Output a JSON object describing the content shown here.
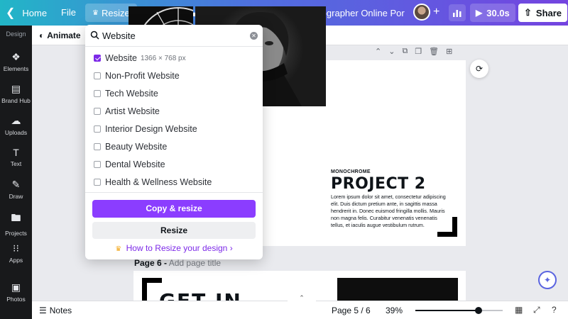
{
  "topbar": {
    "home_label": "Home",
    "file_label": "File",
    "resize_label": "Resize",
    "title": "White Black Modern Photographer Online Portf…",
    "play_label": "30.0s",
    "share_label": "Share"
  },
  "sidebar": {
    "design_label": "Design",
    "items": [
      {
        "label": "Elements",
        "icon": "elements-icon"
      },
      {
        "label": "Brand Hub",
        "icon": "brand-hub-icon"
      },
      {
        "label": "Uploads",
        "icon": "uploads-icon"
      },
      {
        "label": "Text",
        "icon": "text-icon"
      },
      {
        "label": "Draw",
        "icon": "draw-icon"
      },
      {
        "label": "Projects",
        "icon": "projects-icon"
      },
      {
        "label": "Apps",
        "icon": "apps-icon"
      },
      {
        "label": "Photos",
        "icon": "photos-icon"
      }
    ]
  },
  "toolbar": {
    "animate_label": "Animate"
  },
  "resize_panel": {
    "search_value": "Website",
    "options": [
      {
        "label": "Website",
        "dims": "1366 × 768 px",
        "checked": true
      },
      {
        "label": "Non-Profit Website",
        "checked": false
      },
      {
        "label": "Tech Website",
        "checked": false
      },
      {
        "label": "Artist Website",
        "checked": false
      },
      {
        "label": "Interior Design Website",
        "checked": false
      },
      {
        "label": "Beauty Website",
        "checked": false
      },
      {
        "label": "Dental Website",
        "checked": false
      },
      {
        "label": "Health & Wellness Website",
        "checked": false
      }
    ],
    "copy_resize_label": "Copy & resize",
    "resize_label": "Resize",
    "howto_label": "How to Resize your design"
  },
  "canvas": {
    "page5": {
      "kicker": "MONOCHROME",
      "heading": "PROJECT 2",
      "body": "Lorem ipsum dolor sit amet, consectetur adipiscing elit. Duis dictum pretium ante, in sagittis massa hendrerit in. Donec euismod fringilla mollis. Mauris non magna felis. Curabitur venenatis venenatis tellus, et iaculis augue vestibulum rutrum."
    },
    "page6": {
      "label": "Page 6 -",
      "title_placeholder": "Add page title",
      "text": "GET IN"
    }
  },
  "bottombar": {
    "notes_label": "Notes",
    "page_indicator": "Page 5 / 6",
    "zoom": "39%",
    "zoom_fraction": 0.39
  },
  "colors": {
    "accent": "#8b3dff",
    "topbar_start": "#22b6c7",
    "topbar_end": "#7444e0"
  }
}
